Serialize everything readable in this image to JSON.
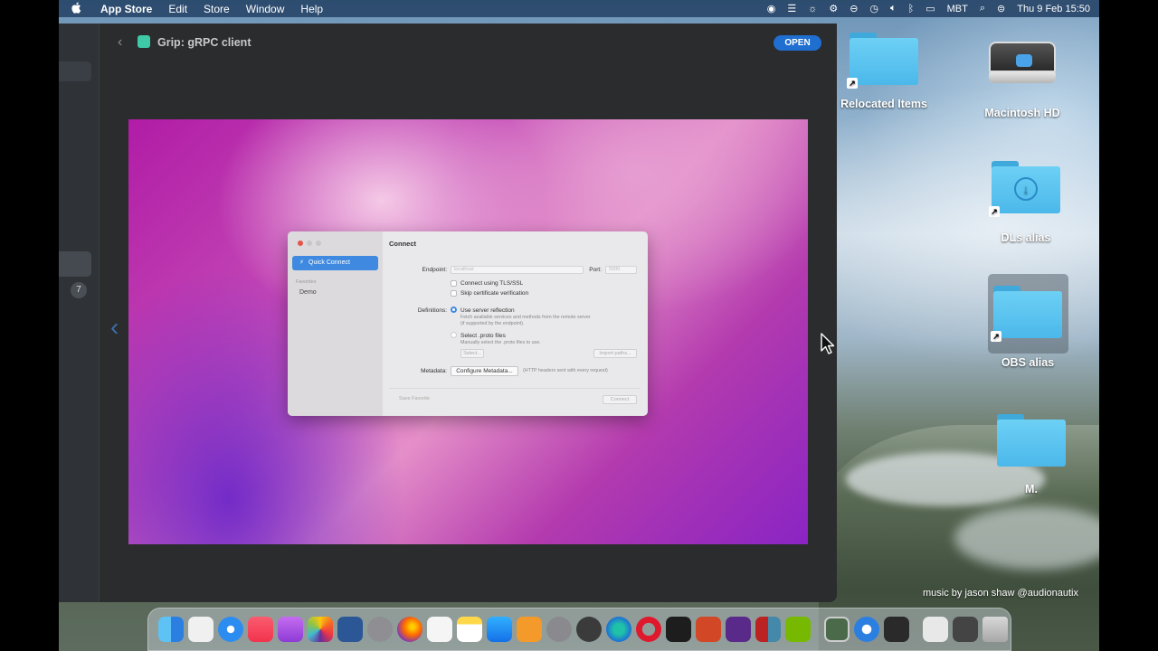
{
  "menubar": {
    "apple_icon": "apple-icon",
    "items": [
      "App Store",
      "Edit",
      "Store",
      "Window",
      "Help"
    ],
    "status": {
      "input": "MBT",
      "datetime": "Thu 9 Feb  15:50"
    }
  },
  "appstore": {
    "title": "Grip: gRPC client",
    "open_label": "OPEN",
    "badge_count": "7",
    "accent": "#1f6fd1"
  },
  "dialog": {
    "quick_connect": "Quick Connect",
    "favorites_label": "Favorites",
    "favorite_items": [
      "Demo"
    ],
    "title": "Connect",
    "endpoint_label": "Endpoint:",
    "endpoint_placeholder": "localhost",
    "port_label": "Port:",
    "port_placeholder": "5000",
    "tls_label": "Connect using TLS/SSL",
    "skip_cert_label": "Skip certificate verification",
    "definitions_label": "Definitions:",
    "reflection_label": "Use server reflection",
    "reflection_sub1": "Fetch available services and methods from the remote server",
    "reflection_sub2": "(if supported by the endpoint).",
    "proto_label": "Select .proto files",
    "proto_sub": "Manually select the .proto files to use.",
    "select_btn": "Select...",
    "import_btn": "Import paths...",
    "metadata_label": "Metadata:",
    "configure_btn": "Configure Metadata...",
    "metadata_hint": "(HTTP headers sent with every request)",
    "save_fav": "Save Favorite",
    "connect": "Connect"
  },
  "desktop": {
    "icons": [
      "Relocated Items",
      "Macintosh HD",
      "DLs alias",
      "OBS alias",
      "M."
    ],
    "credit": "music by jason shaw @audionautix"
  }
}
